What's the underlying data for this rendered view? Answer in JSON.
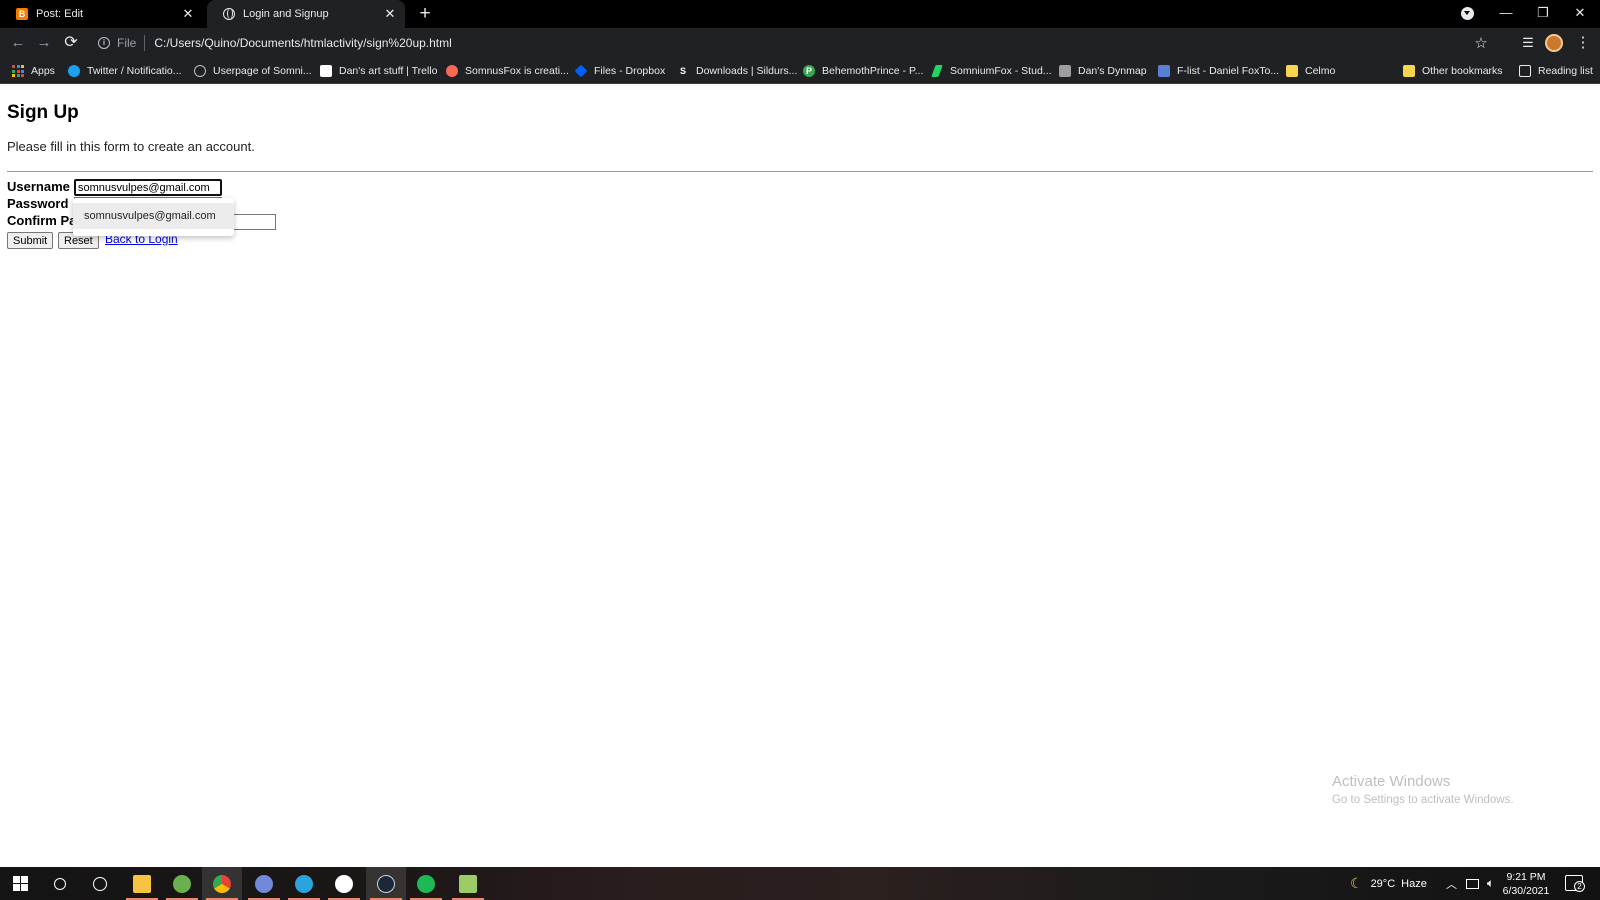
{
  "browser": {
    "tabs": [
      {
        "title": "Post: Edit",
        "favicon": "blogger-icon",
        "favicon_glyph": "B"
      },
      {
        "title": "Login and Signup",
        "favicon": "globe-icon"
      }
    ],
    "tab_close_glyph": "✕",
    "new_tab_glyph": "+",
    "window": {
      "minimize": "—",
      "restore": "❐",
      "close": "✕"
    },
    "toolbar": {
      "back": "←",
      "forward": "→",
      "reload": "⟳",
      "scheme_label": "File",
      "url": "C:/Users/Quino/Documents/htmlactivity/sign%20up.html",
      "star": "☆",
      "reading_list_glyph": "☰",
      "menu_glyph": "⋮"
    },
    "bookmarks": [
      {
        "label": "Apps",
        "icon": "apps-grid-icon",
        "color": "#4285f4"
      },
      {
        "label": "Twitter / Notificatio...",
        "icon": "twitter-icon",
        "color": "#1da1f2"
      },
      {
        "label": "Userpage of Somni...",
        "icon": "paw-icon",
        "color": "#bdbdbd"
      },
      {
        "label": "Dan's art stuff | Trello",
        "icon": "trello-icon",
        "color": "#ffffff"
      },
      {
        "label": "SomnusFox is creati...",
        "icon": "patreon-icon",
        "color": "#f96854"
      },
      {
        "label": "Files - Dropbox",
        "icon": "dropbox-icon",
        "color": "#0061ff"
      },
      {
        "label": "Downloads | Sildurs...",
        "icon": "s-letter-icon",
        "color": "#ffffff",
        "glyph": "S"
      },
      {
        "label": "BehemothPrince - P...",
        "icon": "picarto-icon",
        "color": "#34a853",
        "glyph": "P"
      },
      {
        "label": "SomniumFox - Stud...",
        "icon": "studio-icon",
        "color": "#1ed760"
      },
      {
        "label": "Dan's Dynmap",
        "icon": "cube-icon",
        "color": "#9e9e9e"
      },
      {
        "label": "F-list - Daniel FoxTo...",
        "icon": "flist-icon",
        "color": "#5b7fd4"
      },
      {
        "label": "Celmo",
        "icon": "folder-icon",
        "color": "#f9d44e"
      },
      {
        "label": "Other bookmarks",
        "icon": "folder-icon",
        "color": "#f9d44e"
      },
      {
        "label": "Reading list",
        "icon": "reading-list-icon",
        "color": "#e8eaed"
      }
    ]
  },
  "page": {
    "heading": "Sign Up",
    "subtitle": "Please fill in this form to create an account.",
    "fields": {
      "username_label": "Username",
      "username_value": "somnusvulpes@gmail.com",
      "password_label": "Password",
      "confirm_label": "Confirm Pa"
    },
    "buttons": {
      "submit": "Submit",
      "reset": "Reset"
    },
    "back_link": "Back to Login",
    "autofill_option": "somnusvulpes@gmail.com",
    "watermark": {
      "title": "Activate Windows",
      "subtitle": "Go to Settings to activate Windows."
    }
  },
  "taskbar": {
    "apps": [
      {
        "name": "start-icon",
        "color": "#ffffff"
      },
      {
        "name": "search-icon",
        "color": "#ffffff"
      },
      {
        "name": "task-view-icon",
        "color": "#ffffff"
      },
      {
        "name": "file-explorer-icon",
        "color": "#f6c343"
      },
      {
        "name": "minecraft-launcher-icon",
        "color": "#6ab04c"
      },
      {
        "name": "chrome-icon",
        "color": "#ea4335"
      },
      {
        "name": "discord-icon",
        "color": "#7289da"
      },
      {
        "name": "telegram-icon",
        "color": "#2aa3df"
      },
      {
        "name": "wattpad-icon",
        "color": "#ffffff"
      },
      {
        "name": "steam-icon",
        "color": "#1b2838"
      },
      {
        "name": "spotify-icon",
        "color": "#1db954"
      },
      {
        "name": "notepad-icon",
        "color": "#9ccc65"
      }
    ],
    "weather_temp": "29°C",
    "weather_desc": "Haze",
    "time": "9:21 PM",
    "date": "6/30/2021",
    "notification_count": "2"
  }
}
